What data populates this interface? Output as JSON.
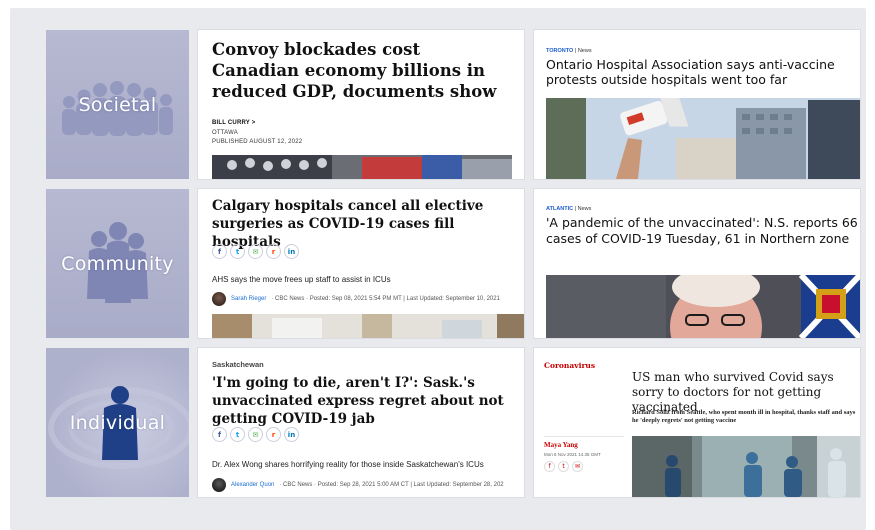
{
  "categories": [
    {
      "label": "Societal"
    },
    {
      "label": "Community"
    },
    {
      "label": "Individual"
    }
  ],
  "cards": {
    "globe": {
      "headline": "Convoy blockades cost Canadian economy billions in reduced GDP, documents show",
      "author": "BILL CURRY >",
      "location": "OTTAWA",
      "published": "PUBLISHED AUGUST 12, 2022"
    },
    "ctv_toronto": {
      "section": "TORONTO",
      "tag": "News",
      "headline": "Ontario Hospital Association says anti-vaccine protests outside hospitals went too far"
    },
    "cbc_calgary": {
      "headline": "Calgary hospitals cancel all elective surgeries as COVID-19 cases fill hospitals",
      "dek": "AHS says the move frees up staff to assist in ICUs",
      "author": "Sarah Rieger",
      "byline_rest": "· CBC News · Posted: Sep 08, 2021 5:54 PM MT | Last Updated: September 10, 2021"
    },
    "ctv_atlantic": {
      "section": "ATLANTIC",
      "tag": "News",
      "headline": "'A pandemic of the unvaccinated': N.S. reports 66 cases of COVID-19 Tuesday, 61 in Northern zone"
    },
    "cbc_sask": {
      "kicker": "Saskatchewan",
      "headline": "'I'm going to die, aren't I?': Sask.'s unvaccinated express regret about not getting COVID-19 jab",
      "dek": "Dr. Alex Wong shares horrifying reality for those inside Saskatchewan's ICUs",
      "author": "Alexander Quon",
      "byline_rest": "· CBC News · Posted: Sep 28, 2021 5:00 AM CT | Last Updated: September 28, 202"
    },
    "guardian": {
      "section": "Coronavirus",
      "headline": "US man who survived Covid says sorry to doctors for not getting vaccinated",
      "standfirst": "Richard Soliz from Seattle, who spent month ill in hospital, thanks staff and says he 'deeply regrets' not getting vaccine",
      "author": "Maya Yang",
      "date": "Mon 8 Nov 2021 14.35 GMT",
      "social": [
        "f",
        "t",
        "✉"
      ]
    }
  },
  "share_icons": [
    "f",
    "t",
    "✉",
    "r",
    "in"
  ],
  "colors": {
    "board": "#e9eaee",
    "category_tile": "#b7b9d2",
    "silhouette": "#8d93bb",
    "individual_figure": "#1f3f86",
    "ctv_blue": "#1c5ecf",
    "guardian_red": "#c70000",
    "cbc_link": "#1a6dd1"
  }
}
